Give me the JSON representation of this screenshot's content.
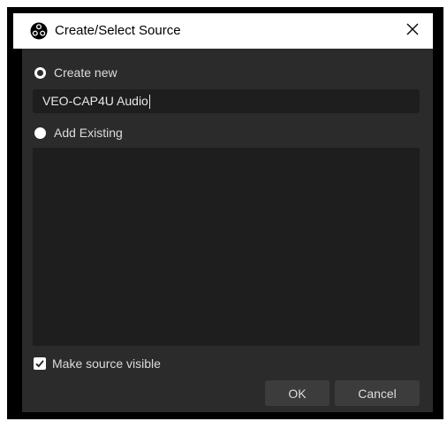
{
  "window": {
    "title": "Create/Select Source",
    "app_icon": "obs-logo-icon",
    "close_icon": "close-icon"
  },
  "create_new": {
    "label": "Create new",
    "selected": true
  },
  "source_name": {
    "value": "VEO-CAP4U Audio"
  },
  "add_existing": {
    "label": "Add Existing",
    "selected": false
  },
  "existing_sources": [],
  "visible_checkbox": {
    "label": "Make source visible",
    "checked": true
  },
  "buttons": {
    "ok": "OK",
    "cancel": "Cancel"
  },
  "colors": {
    "dialog_bg": "#2b2b2b",
    "field_bg": "#1e1e1e",
    "button_bg": "#3c3c3c",
    "text": "#dcdcdc"
  }
}
